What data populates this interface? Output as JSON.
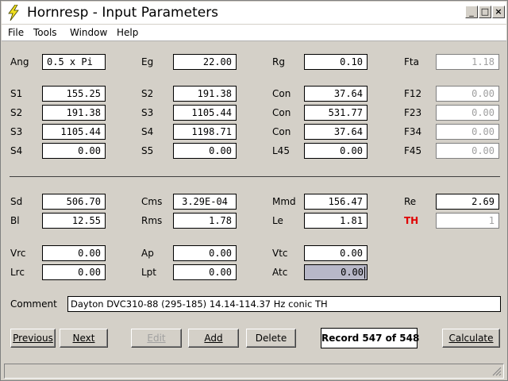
{
  "window": {
    "title": "Hornresp - Input Parameters",
    "controls": {
      "minimize": "_",
      "maximize": "□",
      "close": "×"
    }
  },
  "menu": [
    "File",
    "Tools",
    "Window",
    "Help"
  ],
  "params": {
    "ang": {
      "label": "Ang",
      "value": "0.5 x Pi"
    },
    "eg": {
      "label": "Eg",
      "value": "22.00"
    },
    "rg": {
      "label": "Rg",
      "value": "0.10"
    },
    "fta": {
      "label": "Fta",
      "value": "1.18"
    },
    "c1_s1": {
      "label": "S1",
      "value": "155.25"
    },
    "c1_s2": {
      "label": "S2",
      "value": "191.38"
    },
    "c1_s3": {
      "label": "S3",
      "value": "1105.44"
    },
    "c1_s4": {
      "label": "S4",
      "value": "0.00"
    },
    "c2_s2": {
      "label": "S2",
      "value": "191.38"
    },
    "c2_s3": {
      "label": "S3",
      "value": "1105.44"
    },
    "c2_s4": {
      "label": "S4",
      "value": "1198.71"
    },
    "c2_s5": {
      "label": "S5",
      "value": "0.00"
    },
    "con1": {
      "label": "Con",
      "value": "37.64"
    },
    "con2": {
      "label": "Con",
      "value": "531.77"
    },
    "con3": {
      "label": "Con",
      "value": "37.64"
    },
    "l45": {
      "label": "L45",
      "value": "0.00"
    },
    "f12": {
      "label": "F12",
      "value": "0.00"
    },
    "f23": {
      "label": "F23",
      "value": "0.00"
    },
    "f34": {
      "label": "F34",
      "value": "0.00"
    },
    "f45": {
      "label": "F45",
      "value": "0.00"
    },
    "sd": {
      "label": "Sd",
      "value": "506.70"
    },
    "bl": {
      "label": "Bl",
      "value": "12.55"
    },
    "cms": {
      "label": "Cms",
      "value": "3.29E-04"
    },
    "rms": {
      "label": "Rms",
      "value": "1.78"
    },
    "mmd": {
      "label": "Mmd",
      "value": "156.47"
    },
    "le": {
      "label": "Le",
      "value": "1.81"
    },
    "re": {
      "label": "Re",
      "value": "2.69"
    },
    "th": {
      "label": "TH",
      "value": "1"
    },
    "vrc": {
      "label": "Vrc",
      "value": "0.00"
    },
    "lrc": {
      "label": "Lrc",
      "value": "0.00"
    },
    "ap": {
      "label": "Ap",
      "value": "0.00"
    },
    "lpt": {
      "label": "Lpt",
      "value": "0.00"
    },
    "vtc": {
      "label": "Vtc",
      "value": "0.00"
    },
    "atc": {
      "label": "Atc",
      "value": "0.00"
    }
  },
  "comment": {
    "label": "Comment",
    "value": "Dayton DVC310-88 (295-185) 14.14-114.37 Hz conic TH"
  },
  "buttons": {
    "previous": {
      "label": "Previous"
    },
    "next": {
      "label": "Next"
    },
    "edit": {
      "label": "Edit"
    },
    "add": {
      "label": "Add"
    },
    "delete": {
      "label": "Delete"
    },
    "calculate": {
      "label": "Calculate"
    }
  },
  "record": "Record 547 of 548",
  "colors": {
    "window_bg": "#d4d0c8",
    "th_label": "#e00000",
    "disabled_text": "#a0a0a0",
    "selection": "#b8b8c8"
  }
}
